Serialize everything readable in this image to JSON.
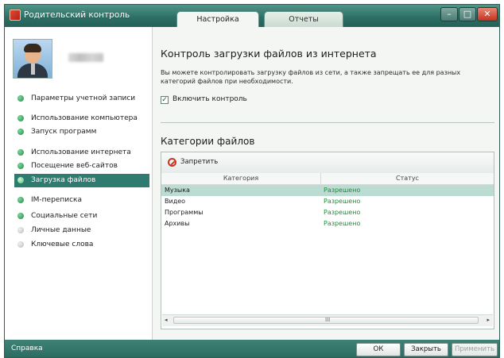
{
  "window": {
    "title": "Родительский контроль",
    "tabs": [
      {
        "label": "Настройка",
        "active": true
      },
      {
        "label": "Отчеты",
        "active": false
      }
    ],
    "controls": {
      "minimize": "–",
      "maximize": "□",
      "close": "✕"
    }
  },
  "sidebar": {
    "username": "",
    "items": [
      {
        "label": "Параметры учетной записи",
        "status": "on"
      },
      {
        "label": "Использование компьютера",
        "status": "on"
      },
      {
        "label": "Запуск программ",
        "status": "on"
      },
      {
        "label": "Использование интернета",
        "status": "on"
      },
      {
        "label": "Посещение веб-сайтов",
        "status": "on"
      },
      {
        "label": "Загрузка файлов",
        "status": "on",
        "active": true
      },
      {
        "label": "IM-переписка",
        "status": "on"
      },
      {
        "label": "Социальные сети",
        "status": "on"
      },
      {
        "label": "Личные данные",
        "status": "off"
      },
      {
        "label": "Ключевые слова",
        "status": "off"
      }
    ]
  },
  "content": {
    "title": "Контроль загрузки файлов из интернета",
    "description": "Вы можете контролировать загрузку файлов из сети, а также запрещать ее для разных категорий файлов при необходимости.",
    "enable_checkbox": {
      "label": "Включить контроль",
      "checked": true,
      "mark": "✓"
    },
    "categories_title": "Категории файлов",
    "toolbar": {
      "block_label": "Запретить"
    },
    "table": {
      "columns": [
        "Категория",
        "Статус"
      ],
      "rows": [
        {
          "category": "Музыка",
          "status": "Разрешено",
          "selected": true
        },
        {
          "category": "Видео",
          "status": "Разрешено"
        },
        {
          "category": "Программы",
          "status": "Разрешено"
        },
        {
          "category": "Архивы",
          "status": "Разрешено"
        }
      ]
    },
    "scrollbar": {
      "left": "◂",
      "right": "▸",
      "grip": "III"
    }
  },
  "footer": {
    "help": "Справка",
    "ok": "ОК",
    "close": "Закрыть",
    "apply": "Применить"
  },
  "colors": {
    "accent": "#2e7b6f",
    "status_allowed": "#1f8d3a",
    "block_icon": "#d2331f"
  }
}
